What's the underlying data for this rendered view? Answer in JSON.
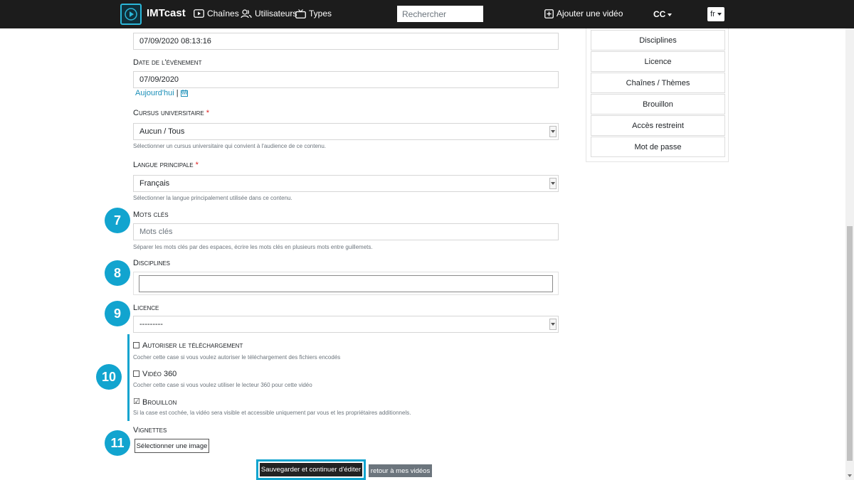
{
  "header": {
    "app_title": "IMTcast",
    "nav": {
      "channels": "Chaînes",
      "users": "Utilisateurs",
      "types": "Types"
    },
    "search_placeholder": "Rechercher",
    "add_video": "Ajouter une vidéo",
    "cc_menu": "CC",
    "language": "fr"
  },
  "form": {
    "date_added_value": "07/09/2020 08:13:16",
    "event_date": {
      "label": "Date de l'évènement",
      "value": "07/09/2020",
      "today_link": "Aujourd'hui",
      "separator": "|"
    },
    "cursus": {
      "label": "Cursus universitaire",
      "required_mark": "*",
      "value": "Aucun / Tous",
      "help": "Sélectionner un cursus universitaire qui convient à l'audience de ce contenu."
    },
    "main_language": {
      "label": "Langue principale",
      "required_mark": "*",
      "value": "Français",
      "help": "Sélectionner la langue principalement utilisée dans ce contenu."
    },
    "keywords": {
      "label": "Mots clés",
      "placeholder": "Mots clés",
      "help": "Séparer les mots clés par des espaces, écrire les mots clés en plusieurs mots entre guillemets."
    },
    "disciplines": {
      "label": "Disciplines",
      "value": ""
    },
    "licence": {
      "label": "Licence",
      "value": "---------"
    },
    "allow_download": {
      "label": "Autoriser le téléchargement",
      "checked": false,
      "help": "Cocher cette case si vous voulez autoriser le téléchargement des fichiers encodés"
    },
    "video_360": {
      "label": "Vidéo 360",
      "checked": false,
      "help": "Cocher cette case si vous voulez utiliser le lecteur 360 pour cette vidéo"
    },
    "draft": {
      "label": "Brouillon",
      "checked": true,
      "check_glyph": "☑",
      "help": "Si la case est cochée, la vidéo sera visible et accessible uniquement par vous et les propriétaires additionnels."
    },
    "thumbnails": {
      "label": "Vignettes",
      "select_button": "Sélectionner une image"
    },
    "actions": {
      "save_continue": "Sauvegarder et continuer d'éditer",
      "back": "retour à mes vidéos"
    }
  },
  "annotations": [
    "7",
    "8",
    "9",
    "10",
    "11"
  ],
  "sidebar": {
    "items": [
      "Disciplines",
      "Licence",
      "Chaînes / Thèmes",
      "Brouillon",
      "Accès restreint",
      "Mot de passe"
    ]
  },
  "colors": {
    "accent": "#12a4cf",
    "header_bg": "#1c1c1c",
    "link": "#1b8fb8",
    "required": "#e02020"
  }
}
